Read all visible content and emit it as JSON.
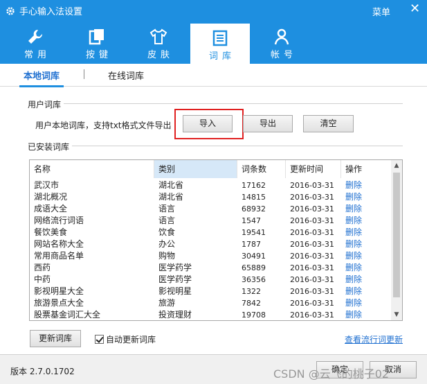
{
  "app": {
    "title": "手心输入法设置",
    "menu_label": "菜单",
    "close_glyph": "✕"
  },
  "tabs": [
    {
      "label": "常用",
      "icon": "wrench-icon"
    },
    {
      "label": "按键",
      "icon": "keys-icon"
    },
    {
      "label": "皮肤",
      "icon": "tshirt-icon"
    },
    {
      "label": "词库",
      "icon": "document-icon",
      "active": true
    },
    {
      "label": "帐号",
      "icon": "user-icon"
    }
  ],
  "subtabs": {
    "local": "本地词库",
    "online": "在线词库"
  },
  "user_lexicon": {
    "title": "用户词库",
    "description": "用户本地词库，支持txt格式文件导出",
    "import_label": "导入",
    "export_label": "导出",
    "clear_label": "清空"
  },
  "installed": {
    "title": "已安装词库",
    "headers": [
      "名称",
      "类别",
      "词条数",
      "更新时间",
      "操作"
    ],
    "rows": [
      [
        "武汉市",
        "湖北省",
        "17162",
        "2016-03-31",
        "删除"
      ],
      [
        "湖北概况",
        "湖北省",
        "14815",
        "2016-03-31",
        "删除"
      ],
      [
        "成语大全",
        "语言",
        "68932",
        "2016-03-31",
        "删除"
      ],
      [
        "网络流行词语",
        "语言",
        "1547",
        "2016-03-31",
        "删除"
      ],
      [
        "餐饮美食",
        "饮食",
        "19541",
        "2016-03-31",
        "删除"
      ],
      [
        "网站名称大全",
        "办公",
        "1787",
        "2016-03-31",
        "删除"
      ],
      [
        "常用商品名单",
        "购物",
        "30491",
        "2016-03-31",
        "删除"
      ],
      [
        "西药",
        "医学药学",
        "65889",
        "2016-03-31",
        "删除"
      ],
      [
        "中药",
        "医学药学",
        "36356",
        "2016-03-31",
        "删除"
      ],
      [
        "影视明星大全",
        "影视明星",
        "1322",
        "2016-03-31",
        "删除"
      ],
      [
        "旅游景点大全",
        "旅游",
        "7842",
        "2016-03-31",
        "删除"
      ],
      [
        "股票基金词汇大全",
        "投资理财",
        "19708",
        "2016-03-31",
        "删除"
      ]
    ]
  },
  "bottom": {
    "update_label": "更新词库",
    "auto_update_label": "自动更新词库",
    "auto_update_checked": true,
    "link_label": "查看流行词更新"
  },
  "footer": {
    "version": "版本  2.7.0.1702",
    "ok_label": "确定",
    "cancel_label": "取消",
    "watermark": "CSDN @云飞的桃子02"
  },
  "colors": {
    "accent": "#1e8fe0",
    "link": "#1e6fd0",
    "highlight": "#e02020"
  }
}
